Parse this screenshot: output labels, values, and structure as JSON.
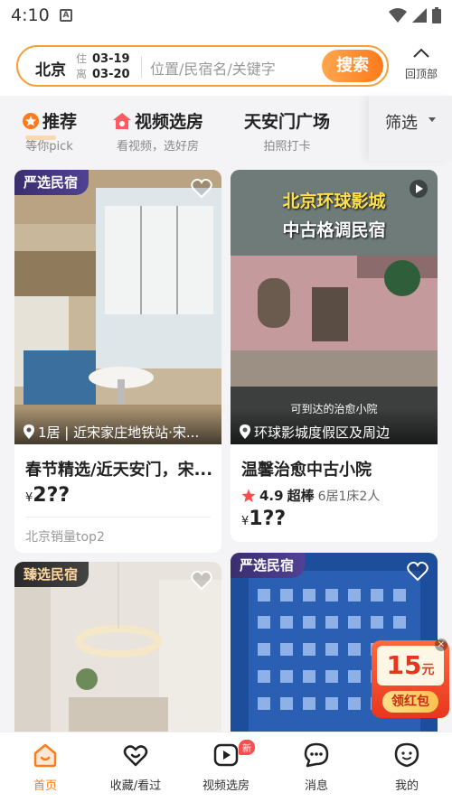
{
  "status_bar": {
    "time": "4:10",
    "notif_letter": "A"
  },
  "search": {
    "city": "北京",
    "checkin_label": "住",
    "checkin_date": "03-19",
    "checkout_label": "离",
    "checkout_date": "03-20",
    "placeholder": "位置/民宿名/关键字",
    "button": "搜索"
  },
  "back_to_top": "回顶部",
  "tabs": [
    {
      "title": "推荐",
      "sub": "等你pick"
    },
    {
      "title": "视频选房",
      "sub": "看视频，选好房"
    },
    {
      "title": "天安门广场",
      "sub": "拍照打卡"
    }
  ],
  "filter": "筛选",
  "cards": [
    {
      "tag": "严选民宿",
      "location": "1居 | 近宋家庄地铁站·宋...",
      "title": "春节精选/近天安门，宋...",
      "currency": "¥",
      "price": "2??",
      "sales": "北京销量top2"
    },
    {
      "overlay_title1": "北京环球影城",
      "overlay_title2": "中古格调民宿",
      "overlay_caption": "可到达的治愈小院",
      "location": "环球影城度假区及周边",
      "title": "温馨治愈中古小院",
      "rating": "4.9",
      "rating_word": "超棒",
      "rooms": "6居1床2人",
      "currency": "¥",
      "price": "1??"
    },
    {
      "tag": "臻选民宿"
    },
    {
      "tag": "严选民宿"
    }
  ],
  "promo": {
    "amount": "15",
    "unit": "元",
    "label": "领红包",
    "close": "×"
  },
  "bottom_nav": [
    {
      "label": "首页"
    },
    {
      "label": "收藏/看过"
    },
    {
      "label": "视频选房",
      "badge": "新"
    },
    {
      "label": "消息"
    },
    {
      "label": "我的"
    }
  ],
  "colors": {
    "accent": "#ff7a1a",
    "brand_border": "#f5a03c",
    "star": "#ff4d4f"
  }
}
